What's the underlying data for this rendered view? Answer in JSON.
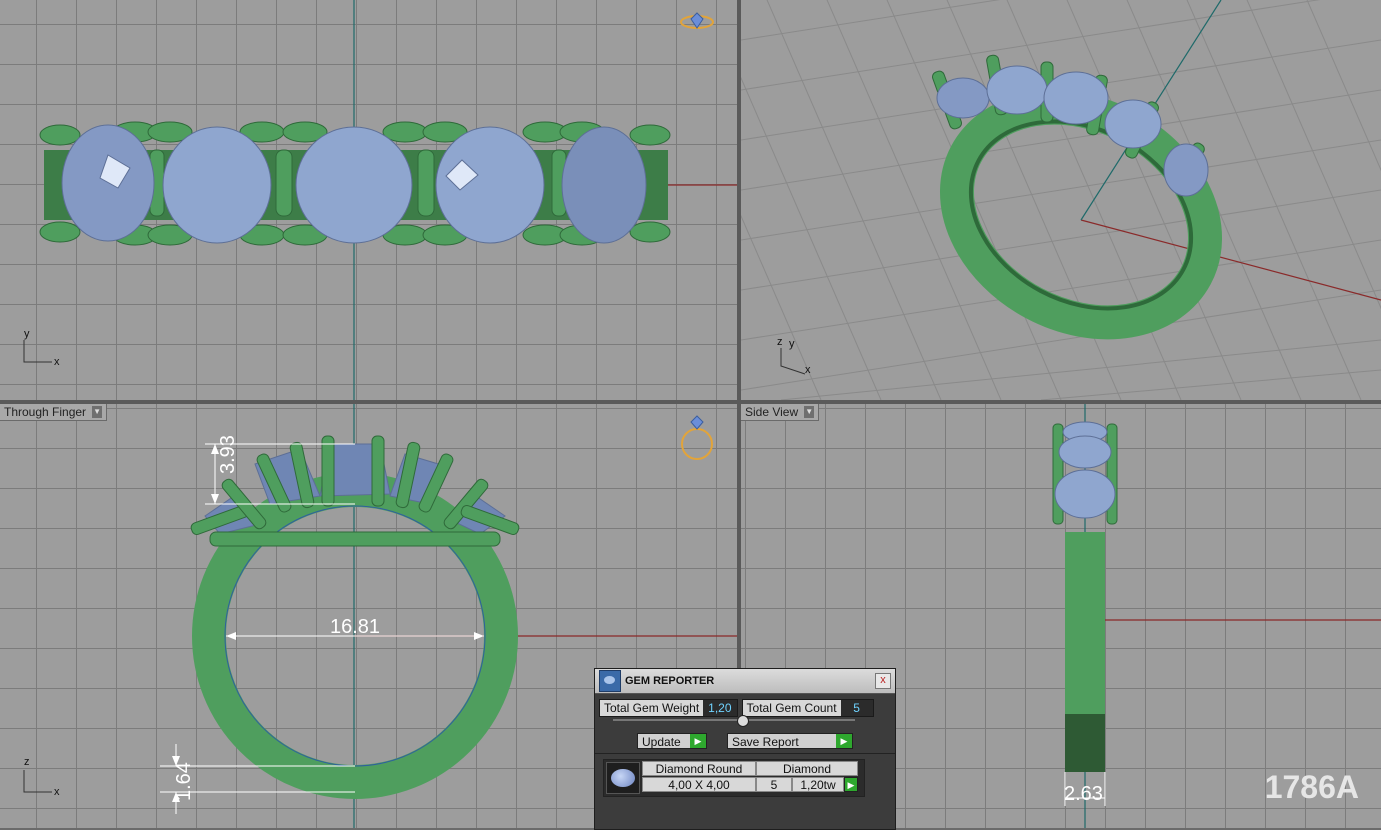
{
  "viewports": {
    "front_label": "Through Finger",
    "side_label": "Side View"
  },
  "axes": {
    "top": {
      "x": "x",
      "y": "y"
    },
    "persp": {
      "x": "x",
      "y": "y",
      "z": "z"
    },
    "front": {
      "x": "x",
      "z": "z"
    }
  },
  "dimensions": {
    "height": "3.93",
    "inner_diameter": "16.81",
    "shank_thickness": "1.64",
    "shank_width": "2.63"
  },
  "watermark": "1786A",
  "gem_reporter": {
    "title": "GEM REPORTER",
    "close_glyph": "x",
    "total_weight_label": "Total Gem Weight",
    "total_weight_value": "1,20",
    "total_count_label": "Total Gem Count",
    "total_count_value": "5",
    "update_label": "Update",
    "save_report_label": "Save Report",
    "row": {
      "gem": "Diamond Round",
      "material": "Diamond",
      "size": "4,00 X 4,00",
      "count": "5",
      "weight": "1,20tw"
    }
  },
  "colors": {
    "metal": "#4f9e5e",
    "gem": "#8fa6cf",
    "viewport_bg": "#9d9d9d",
    "axis_red": "#8a2a2a",
    "axis_green": "#1f6a6a"
  },
  "icons": [
    "ring-top-icon",
    "ring-front-icon",
    "gem-reporter-icon",
    "dropdown-arrow-icon",
    "play-arrow-icon"
  ]
}
